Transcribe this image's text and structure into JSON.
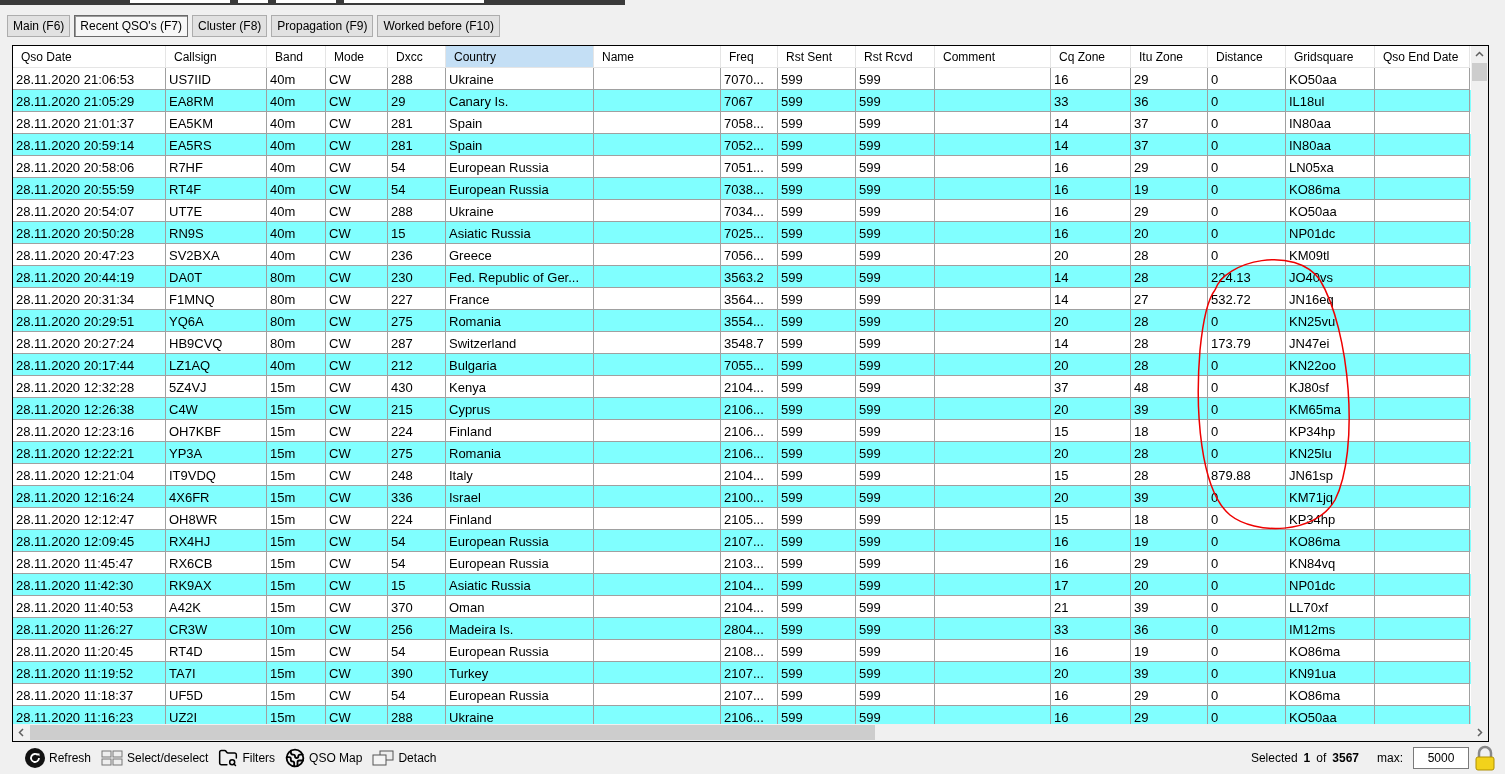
{
  "tabs": [
    {
      "label": "Main (F6)",
      "selected": false
    },
    {
      "label": "Recent QSO's (F7)",
      "selected": true
    },
    {
      "label": "Cluster (F8)",
      "selected": false
    },
    {
      "label": "Propagation (F9)",
      "selected": false
    },
    {
      "label": "Worked before (F10)",
      "selected": false
    }
  ],
  "table": {
    "columns": [
      {
        "label": "Qso Date",
        "highlighted": false
      },
      {
        "label": "Callsign",
        "highlighted": false
      },
      {
        "label": "Band",
        "highlighted": false
      },
      {
        "label": "Mode",
        "highlighted": false
      },
      {
        "label": "Dxcc",
        "highlighted": false
      },
      {
        "label": "Country",
        "highlighted": true
      },
      {
        "label": "Name",
        "highlighted": false
      },
      {
        "label": "Freq",
        "highlighted": false
      },
      {
        "label": "Rst Sent",
        "highlighted": false
      },
      {
        "label": "Rst Rcvd",
        "highlighted": false
      },
      {
        "label": "Comment",
        "highlighted": false
      },
      {
        "label": "Cq Zone",
        "highlighted": false
      },
      {
        "label": "Itu Zone",
        "highlighted": false
      },
      {
        "label": "Distance",
        "highlighted": false
      },
      {
        "label": "Gridsquare",
        "highlighted": false
      },
      {
        "label": "Qso End Date",
        "highlighted": false
      }
    ],
    "rows": [
      [
        "28.11.2020 21:06:53",
        "US7IID",
        "40m",
        "CW",
        "288",
        "Ukraine",
        "",
        "7070...",
        "599",
        "599",
        "",
        "16",
        "29",
        "0",
        "KO50aa",
        ""
      ],
      [
        "28.11.2020 21:05:29",
        "EA8RM",
        "40m",
        "CW",
        "29",
        "Canary Is.",
        "",
        "7067",
        "599",
        "599",
        "",
        "33",
        "36",
        "0",
        "IL18ul",
        ""
      ],
      [
        "28.11.2020 21:01:37",
        "EA5KM",
        "40m",
        "CW",
        "281",
        "Spain",
        "",
        "7058...",
        "599",
        "599",
        "",
        "14",
        "37",
        "0",
        "IN80aa",
        ""
      ],
      [
        "28.11.2020 20:59:14",
        "EA5RS",
        "40m",
        "CW",
        "281",
        "Spain",
        "",
        "7052...",
        "599",
        "599",
        "",
        "14",
        "37",
        "0",
        "IN80aa",
        ""
      ],
      [
        "28.11.2020 20:58:06",
        "R7HF",
        "40m",
        "CW",
        "54",
        "European Russia",
        "",
        "7051...",
        "599",
        "599",
        "",
        "16",
        "29",
        "0",
        "LN05xa",
        ""
      ],
      [
        "28.11.2020 20:55:59",
        "RT4F",
        "40m",
        "CW",
        "54",
        "European Russia",
        "",
        "7038...",
        "599",
        "599",
        "",
        "16",
        "19",
        "0",
        "KO86ma",
        ""
      ],
      [
        "28.11.2020 20:54:07",
        "UT7E",
        "40m",
        "CW",
        "288",
        "Ukraine",
        "",
        "7034...",
        "599",
        "599",
        "",
        "16",
        "29",
        "0",
        "KO50aa",
        ""
      ],
      [
        "28.11.2020 20:50:28",
        "RN9S",
        "40m",
        "CW",
        "15",
        "Asiatic Russia",
        "",
        "7025...",
        "599",
        "599",
        "",
        "16",
        "20",
        "0",
        "NP01dc",
        ""
      ],
      [
        "28.11.2020 20:47:23",
        "SV2BXA",
        "40m",
        "CW",
        "236",
        "Greece",
        "",
        "7056...",
        "599",
        "599",
        "",
        "20",
        "28",
        "0",
        "KM09tl",
        ""
      ],
      [
        "28.11.2020 20:44:19",
        "DA0T",
        "80m",
        "CW",
        "230",
        "Fed. Republic of Ger...",
        "",
        "3563.2",
        "599",
        "599",
        "",
        "14",
        "28",
        "224.13",
        "JO40vs",
        ""
      ],
      [
        "28.11.2020 20:31:34",
        "F1MNQ",
        "80m",
        "CW",
        "227",
        "France",
        "",
        "3564...",
        "599",
        "599",
        "",
        "14",
        "27",
        "532.72",
        "JN16eq",
        ""
      ],
      [
        "28.11.2020 20:29:51",
        "YQ6A",
        "80m",
        "CW",
        "275",
        "Romania",
        "",
        "3554...",
        "599",
        "599",
        "",
        "20",
        "28",
        "0",
        "KN25vu",
        ""
      ],
      [
        "28.11.2020 20:27:24",
        "HB9CVQ",
        "80m",
        "CW",
        "287",
        "Switzerland",
        "",
        "3548.7",
        "599",
        "599",
        "",
        "14",
        "28",
        "173.79",
        "JN47ei",
        ""
      ],
      [
        "28.11.2020 20:17:44",
        "LZ1AQ",
        "40m",
        "CW",
        "212",
        "Bulgaria",
        "",
        "7055...",
        "599",
        "599",
        "",
        "20",
        "28",
        "0",
        "KN22oo",
        ""
      ],
      [
        "28.11.2020 12:32:28",
        "5Z4VJ",
        "15m",
        "CW",
        "430",
        "Kenya",
        "",
        "2104...",
        "599",
        "599",
        "",
        "37",
        "48",
        "0",
        "KJ80sf",
        ""
      ],
      [
        "28.11.2020 12:26:38",
        "C4W",
        "15m",
        "CW",
        "215",
        "Cyprus",
        "",
        "2106...",
        "599",
        "599",
        "",
        "20",
        "39",
        "0",
        "KM65ma",
        ""
      ],
      [
        "28.11.2020 12:23:16",
        "OH7KBF",
        "15m",
        "CW",
        "224",
        "Finland",
        "",
        "2106...",
        "599",
        "599",
        "",
        "15",
        "18",
        "0",
        "KP34hp",
        ""
      ],
      [
        "28.11.2020 12:22:21",
        "YP3A",
        "15m",
        "CW",
        "275",
        "Romania",
        "",
        "2106...",
        "599",
        "599",
        "",
        "20",
        "28",
        "0",
        "KN25lu",
        ""
      ],
      [
        "28.11.2020 12:21:04",
        "IT9VDQ",
        "15m",
        "CW",
        "248",
        "Italy",
        "",
        "2104...",
        "599",
        "599",
        "",
        "15",
        "28",
        "879.88",
        "JN61sp",
        ""
      ],
      [
        "28.11.2020 12:16:24",
        "4X6FR",
        "15m",
        "CW",
        "336",
        "Israel",
        "",
        "2100...",
        "599",
        "599",
        "",
        "20",
        "39",
        "0",
        "KM71jq",
        ""
      ],
      [
        "28.11.2020 12:12:47",
        "OH8WR",
        "15m",
        "CW",
        "224",
        "Finland",
        "",
        "2105...",
        "599",
        "599",
        "",
        "15",
        "18",
        "0",
        "KP34hp",
        ""
      ],
      [
        "28.11.2020 12:09:45",
        "RX4HJ",
        "15m",
        "CW",
        "54",
        "European Russia",
        "",
        "2107...",
        "599",
        "599",
        "",
        "16",
        "19",
        "0",
        "KO86ma",
        ""
      ],
      [
        "28.11.2020 11:45:47",
        "RX6CB",
        "15m",
        "CW",
        "54",
        "European Russia",
        "",
        "2103...",
        "599",
        "599",
        "",
        "16",
        "29",
        "0",
        "KN84vq",
        ""
      ],
      [
        "28.11.2020 11:42:30",
        "RK9AX",
        "15m",
        "CW",
        "15",
        "Asiatic Russia",
        "",
        "2104...",
        "599",
        "599",
        "",
        "17",
        "20",
        "0",
        "NP01dc",
        ""
      ],
      [
        "28.11.2020 11:40:53",
        "A42K",
        "15m",
        "CW",
        "370",
        "Oman",
        "",
        "2104...",
        "599",
        "599",
        "",
        "21",
        "39",
        "0",
        "LL70xf",
        ""
      ],
      [
        "28.11.2020 11:26:27",
        "CR3W",
        "10m",
        "CW",
        "256",
        "Madeira Is.",
        "",
        "2804...",
        "599",
        "599",
        "",
        "33",
        "36",
        "0",
        "IM12ms",
        ""
      ],
      [
        "28.11.2020 11:20:45",
        "RT4D",
        "15m",
        "CW",
        "54",
        "European Russia",
        "",
        "2108...",
        "599",
        "599",
        "",
        "16",
        "19",
        "0",
        "KO86ma",
        ""
      ],
      [
        "28.11.2020 11:19:52",
        "TA7I",
        "15m",
        "CW",
        "390",
        "Turkey",
        "",
        "2107...",
        "599",
        "599",
        "",
        "20",
        "39",
        "0",
        "KN91ua",
        ""
      ],
      [
        "28.11.2020 11:18:37",
        "UF5D",
        "15m",
        "CW",
        "54",
        "European Russia",
        "",
        "2107...",
        "599",
        "599",
        "",
        "16",
        "29",
        "0",
        "KO86ma",
        ""
      ],
      [
        "28.11.2020 11:16:23",
        "UZ2I",
        "15m",
        "CW",
        "288",
        "Ukraine",
        "",
        "2106...",
        "599",
        "599",
        "",
        "16",
        "29",
        "0",
        "KO50aa",
        ""
      ]
    ]
  },
  "annotation": {
    "kind": "circle"
  },
  "toolbar": [
    {
      "label": "Refresh",
      "kind": "refresh"
    },
    {
      "label": "Select/deselect",
      "kind": "select"
    },
    {
      "label": "Filters",
      "kind": "filters"
    },
    {
      "label": "QSO Map",
      "kind": "map"
    },
    {
      "label": "Detach",
      "kind": "detach"
    }
  ],
  "status": {
    "selected_label": "Selected",
    "selected": "1",
    "of_label": "of",
    "total": "3567",
    "max_label": "max:",
    "max_value": "5000",
    "locked": true
  }
}
